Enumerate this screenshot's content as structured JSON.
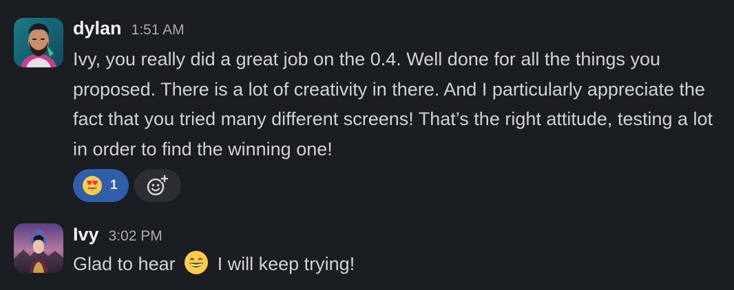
{
  "messages": [
    {
      "sender": "dylan",
      "time": "1:51 AM",
      "avatar_icon": "bearded-man-avatar-icon",
      "text": "Ivy, you really did a great job on the 0.4. Well done for all the things you proposed. There is a lot of creativity in there. And I particularly appreciate the fact that you tried many different screens! That’s the right attitude, testing a lot in order to find the winning one!",
      "reactions": [
        {
          "emoji": "heart-eyes-emoji-icon",
          "count": "1"
        }
      ],
      "add_reaction_icon": "add-reaction-icon"
    },
    {
      "sender": "Ivy",
      "time": "3:02 PM",
      "avatar_icon": "woman-fantasy-avatar-icon",
      "text_before": "Glad to hear",
      "inline_emoji": "grinning-face-emoji-icon",
      "text_after": "I will keep trying!"
    }
  ],
  "colors": {
    "background": "#1a1d21",
    "reaction_active": "#2f5fa8",
    "reaction_button": "#2b2e33",
    "text": "#d1d2d3",
    "timestamp": "#ababad"
  }
}
